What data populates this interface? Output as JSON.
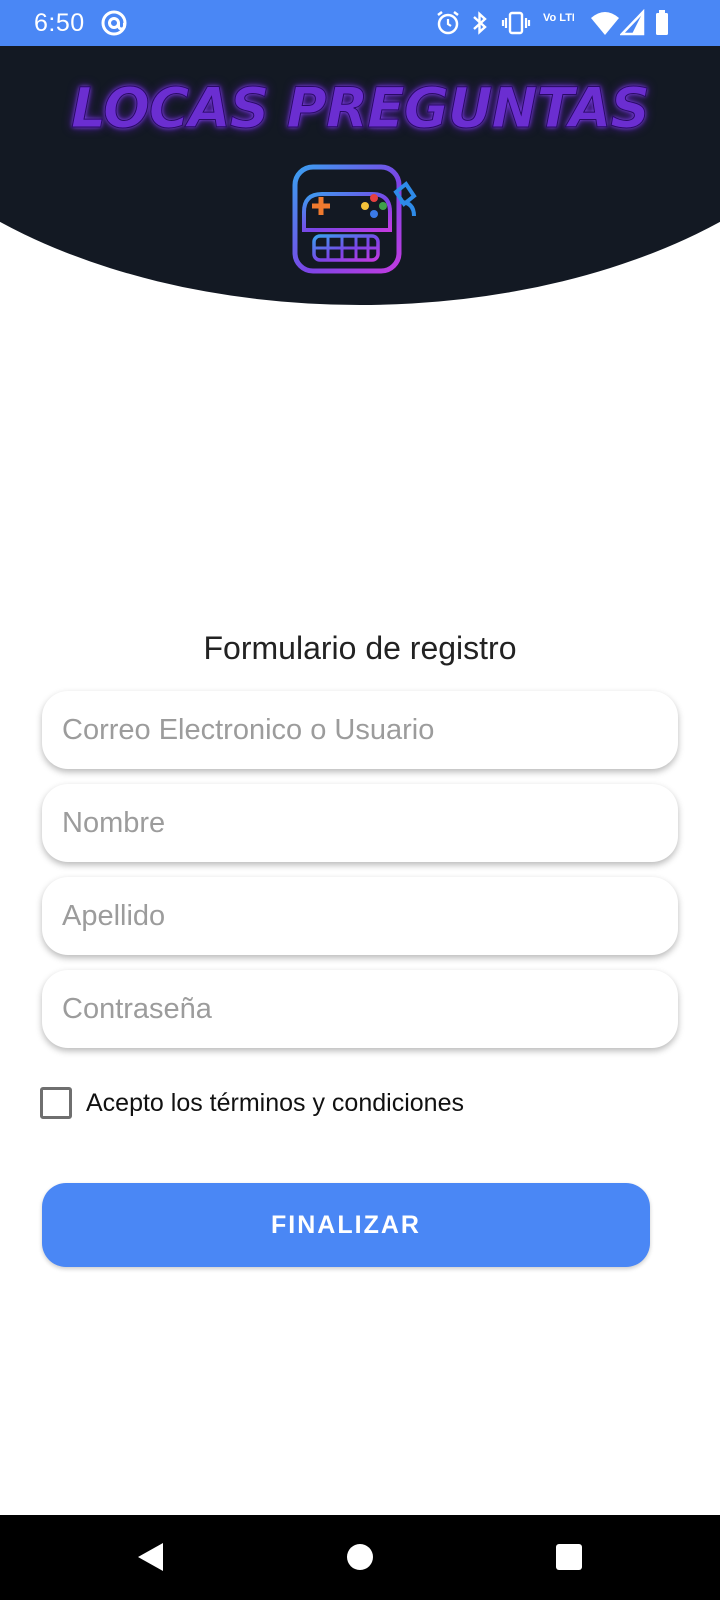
{
  "status_bar": {
    "time": "6:50",
    "network_label": "Vo LTE",
    "icons": [
      "at-sign-icon",
      "alarm-icon",
      "bluetooth-icon",
      "vibrate-icon",
      "volte-icon",
      "wifi-icon",
      "signal-icon",
      "battery-icon"
    ]
  },
  "header": {
    "app_title": "LOCAS PREGUNTAS",
    "logo_icon": "game-controller-icon"
  },
  "form": {
    "title": "Formulario de registro",
    "fields": [
      {
        "placeholder": "Correo Electronico o Usuario",
        "value": ""
      },
      {
        "placeholder": "Nombre",
        "value": ""
      },
      {
        "placeholder": "Apellido",
        "value": ""
      },
      {
        "placeholder": "Contraseña",
        "value": ""
      }
    ],
    "terms_label": "Acepto los términos y condiciones",
    "terms_checked": false,
    "submit_label": "FINALIZAR"
  },
  "nav_bar": {
    "buttons": [
      "back-icon",
      "home-icon",
      "recents-icon"
    ]
  },
  "colors": {
    "accent": "#4a87f5",
    "header_bg": "#131923",
    "title_purple": "#6b2ed1",
    "nav_bg": "#000000"
  }
}
